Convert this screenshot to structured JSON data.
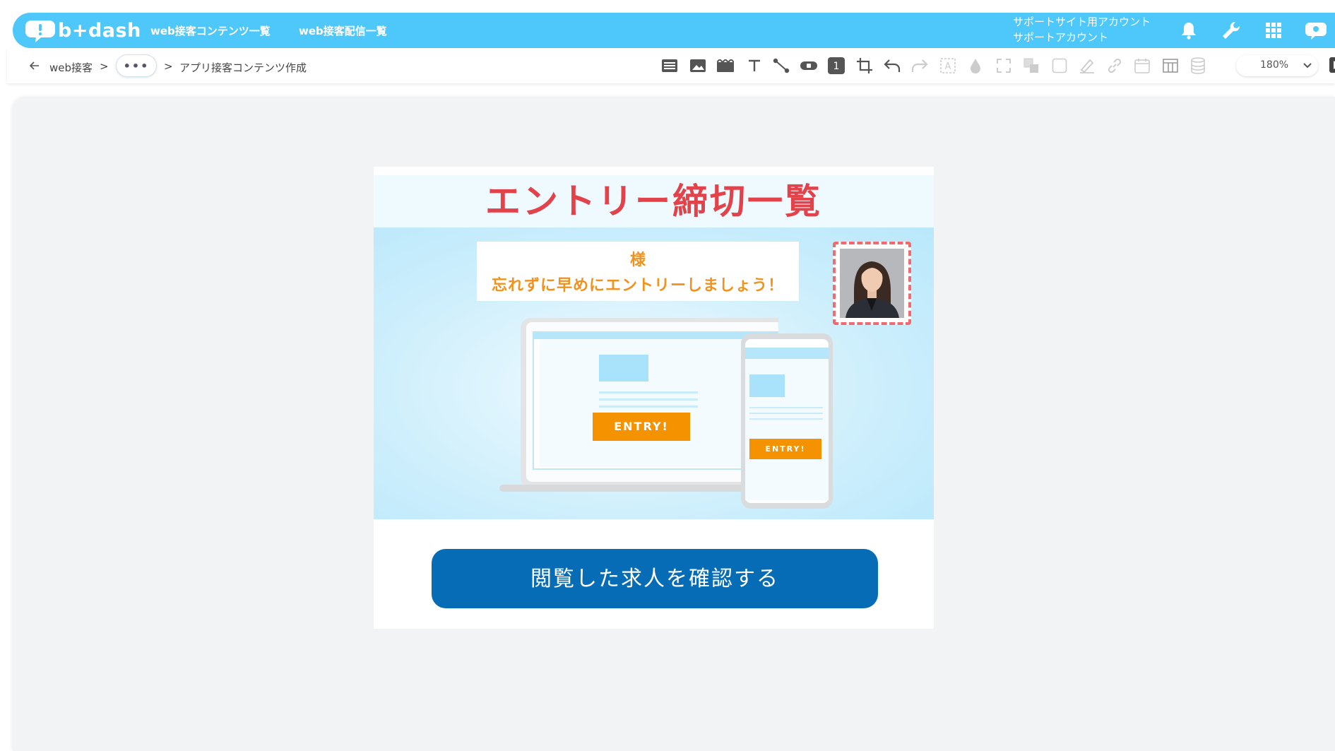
{
  "app": {
    "logo_text": "b+dash"
  },
  "header": {
    "nav": [
      {
        "label": "web接客コンテンツ一覧"
      },
      {
        "label": "web接客配信一覧"
      }
    ],
    "account_line1": "サポートサイト用アカウント",
    "account_line2": "サポートアカウント",
    "icons": [
      "bell-icon",
      "wrench-icon",
      "grid-icon",
      "support-icon"
    ]
  },
  "breadcrumb": {
    "root": "web接客",
    "sep1": ">",
    "ellipsis": "•••",
    "sep2": ">",
    "current": "アプリ接客コンテンツ作成"
  },
  "toolbar": {
    "badge_label": "1",
    "zoom_value": "180%",
    "icons": [
      "list-icon",
      "image-icon",
      "video-icon",
      "text-icon",
      "connector-icon",
      "button-icon",
      "number-icon",
      "crop-icon",
      "undo-icon",
      "redo-icon",
      "text-frame-icon",
      "fill-icon",
      "expand-icon",
      "layer-icon",
      "shape-icon",
      "pen-icon",
      "link-icon",
      "calendar-icon",
      "table-icon",
      "database-icon",
      "play-icon"
    ]
  },
  "content": {
    "title": "エントリー締切一覧",
    "message_line1": "様",
    "message_line2": "忘れずに早めにエントリーしましょう！",
    "laptop_entry_label": "ENTRY!",
    "phone_entry_label": "ENTRY!",
    "cta_label": "閲覧した求人を確認する"
  },
  "colors": {
    "header_bg": "#4ec8fb",
    "title_red": "#e2434a",
    "message_orange": "#f0921e",
    "entry_orange": "#f59200",
    "cta_blue": "#066cb5",
    "selection_dash": "#f06a72"
  }
}
